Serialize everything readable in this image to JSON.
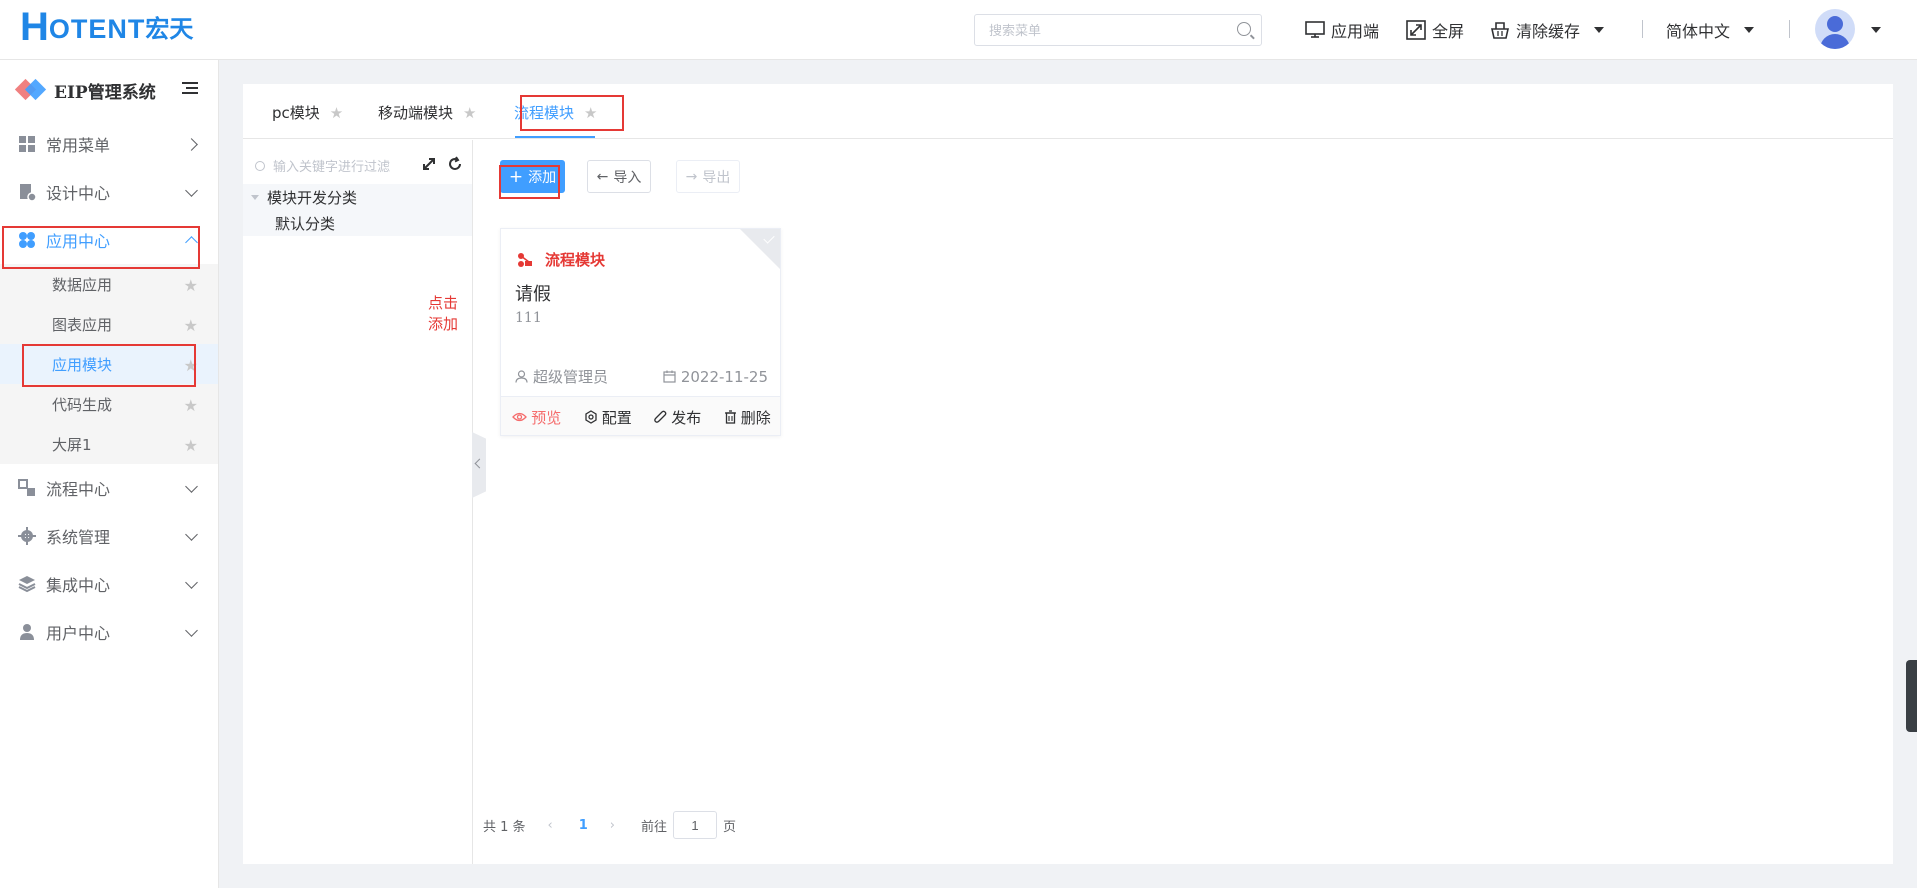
{
  "header": {
    "logo_h": "H",
    "logo_rest": "OTENT",
    "logo_cn": "宏天",
    "search_placeholder": "搜索菜单",
    "items": [
      {
        "label": "应用端",
        "icon": "monitor-icon"
      },
      {
        "label": "全屏",
        "icon": "fullscreen-icon"
      },
      {
        "label": "清除缓存",
        "icon": "basket-icon"
      }
    ],
    "language": "简体中文"
  },
  "sidebar": {
    "system_title": "EIP管理系统",
    "menu": [
      {
        "label": "常用菜单",
        "icon": "dashboard-icon"
      },
      {
        "label": "设计中心",
        "icon": "design-icon"
      },
      {
        "label": "应用中心",
        "icon": "apps-icon"
      },
      {
        "label": "流程中心",
        "icon": "flow-icon"
      },
      {
        "label": "系统管理",
        "icon": "gear-icon"
      },
      {
        "label": "集成中心",
        "icon": "layers-icon"
      },
      {
        "label": "用户中心",
        "icon": "user-icon"
      }
    ],
    "app_center_items": [
      "数据应用",
      "图表应用",
      "应用模块",
      "代码生成",
      "大屏1"
    ]
  },
  "tabs": [
    "pc模块",
    "移动端模块",
    "流程模块"
  ],
  "tree": {
    "filter_placeholder": "输入关键字进行过滤",
    "root": "模块开发分类",
    "child": "默认分类"
  },
  "hint": "点击添加",
  "toolbar": {
    "add": "添加",
    "import": "导入",
    "export": "导出"
  },
  "card": {
    "type": "流程模块",
    "name": "请假",
    "desc": "111",
    "author": "超级管理员",
    "date": "2022-11-25",
    "actions": {
      "preview": "预览",
      "config": "配置",
      "publish": "发布",
      "delete": "删除"
    }
  },
  "pager": {
    "total": "共 1 条",
    "current": "1",
    "goto": "前往",
    "page_input": "1",
    "page_suffix": "页"
  },
  "colors": {
    "primary": "#409eff",
    "highlight": "#e53935",
    "brand": "#1f86e6"
  }
}
